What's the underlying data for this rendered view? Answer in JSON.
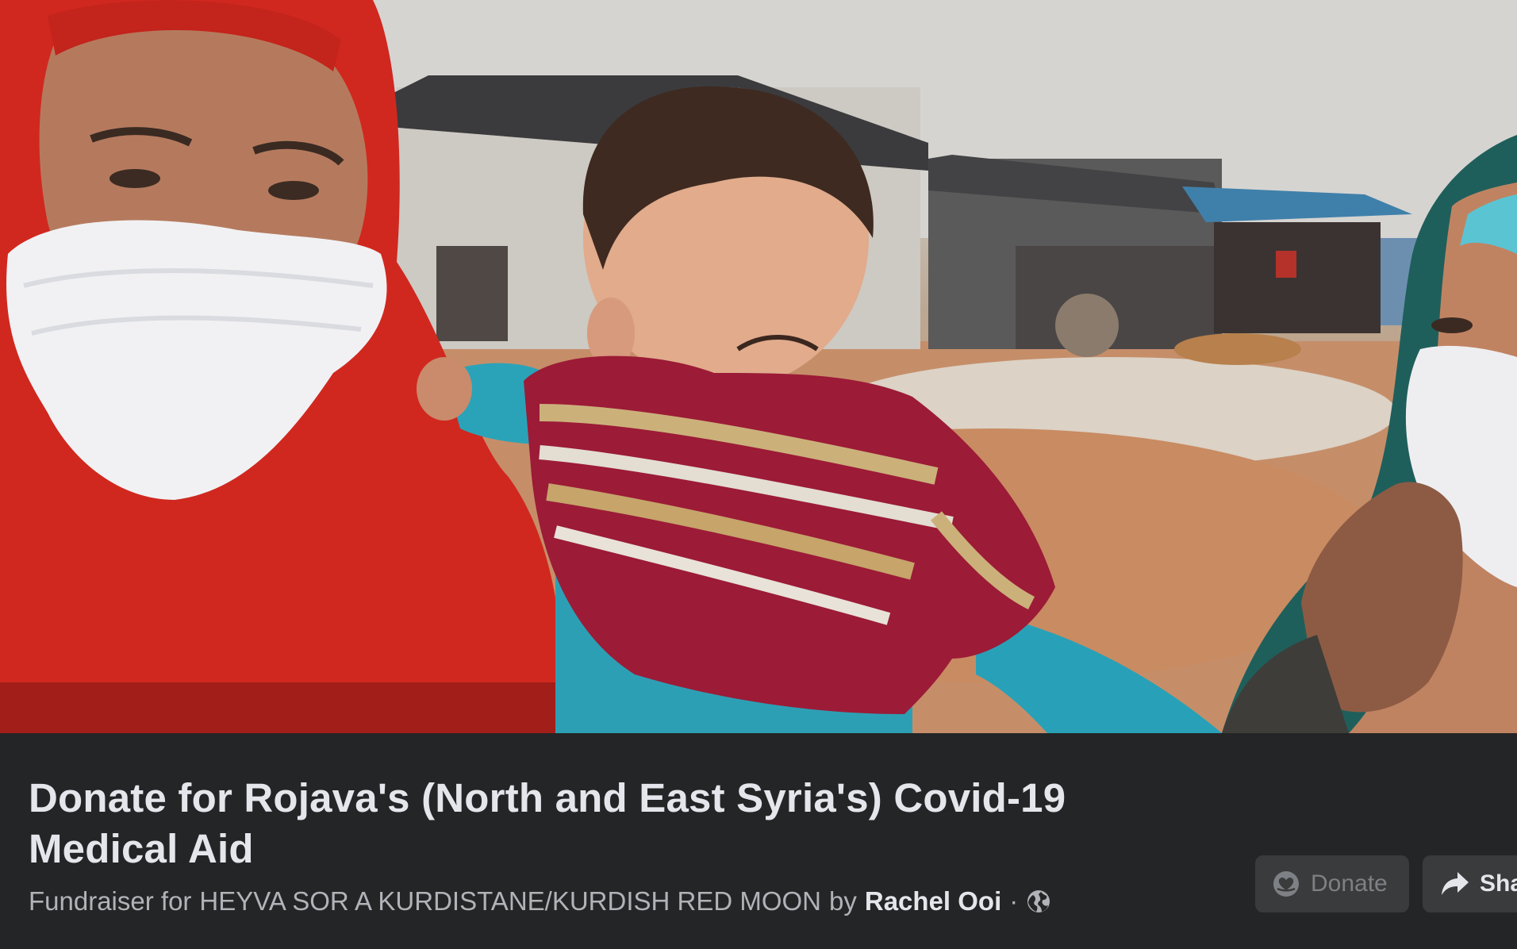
{
  "cover_photo": {
    "icon": "cover-photo"
  },
  "fundraiser": {
    "title": "Donate for Rojava's (North and East Syria's) Covid-19 Medical Aid",
    "subtitle_prefix": "Fundraiser for",
    "organization": "HEYVA SOR A KURDISTANE/KURDISH RED MOON",
    "by_label": "by",
    "author": "Rachel Ooi",
    "separator": "·",
    "privacy_icon": "globe-icon"
  },
  "actions": {
    "donate_label": "Donate",
    "donate_icon": "donate-heart-icon",
    "share_label": "Sha",
    "share_icon": "share-arrow-icon"
  },
  "colors": {
    "panel_background": "#242526",
    "button_background": "#3a3b3c",
    "primary_text": "#e4e6eb",
    "secondary_text": "#b0b3b8",
    "disabled_text": "#7d8084"
  }
}
